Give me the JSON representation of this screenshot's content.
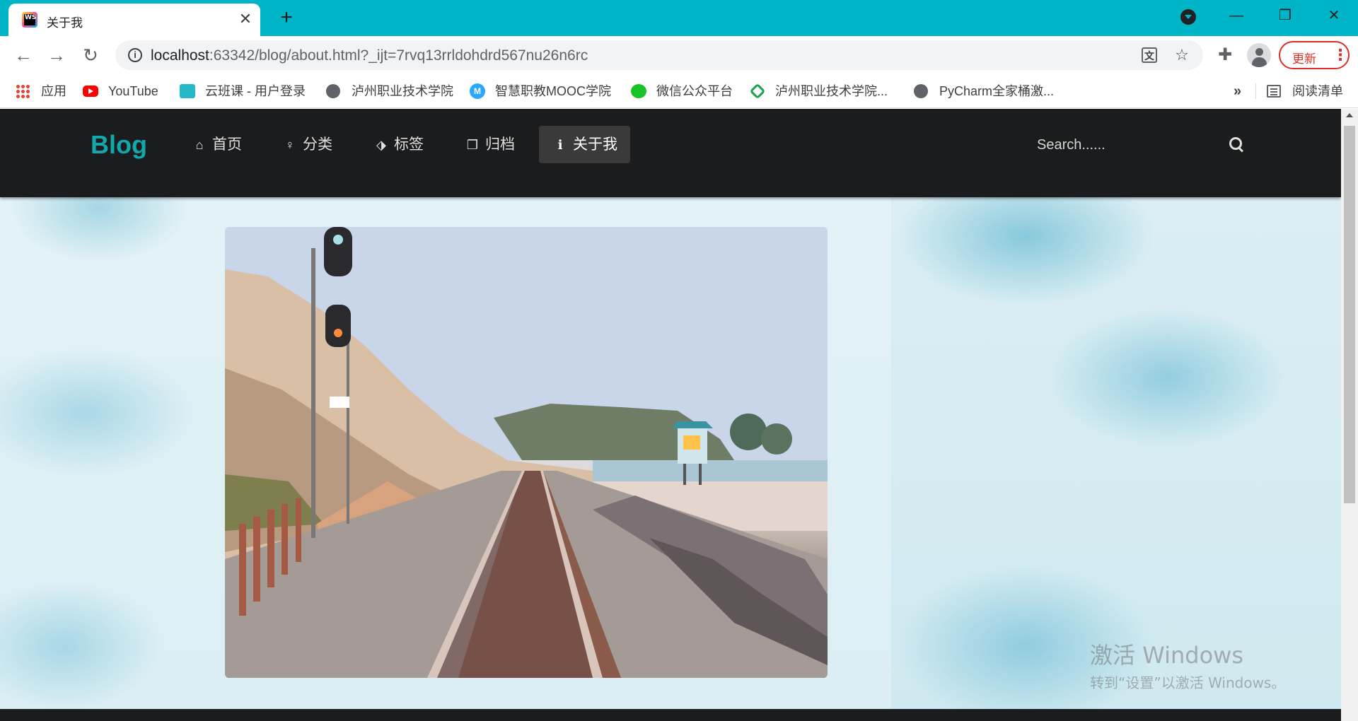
{
  "browser": {
    "tab_title": "关于我",
    "tab_close": "✕",
    "new_tab": "+",
    "window_controls": {
      "minimize": "—",
      "restore": "❐",
      "close": "✕"
    },
    "url_host": "localhost",
    "url_rest": ":63342/blog/about.html?_ijt=7rvq13rrldohdrd567nu26n6rc",
    "update_label": "更新",
    "update_menu": "⋮",
    "bookmarks": [
      {
        "label": "应用",
        "icon": "apps-grid-icon"
      },
      {
        "label": "YouTube",
        "icon": "youtube-icon"
      },
      {
        "label": "云班课 - 用户登录",
        "icon": "cloud-class-icon"
      },
      {
        "label": "泸州职业技术学院",
        "icon": "globe-icon"
      },
      {
        "label": "智慧职教MOOC学院",
        "icon": "mooc-icon"
      },
      {
        "label": "微信公众平台",
        "icon": "wechat-icon"
      },
      {
        "label": "泸州职业技术学院...",
        "icon": "school-icon"
      },
      {
        "label": "PyCharm全家桶激...",
        "icon": "globe-icon"
      }
    ],
    "bookmarks_more": "»",
    "reading_list": "阅读清单",
    "mooc_letter": "M"
  },
  "site": {
    "brand": "Blog",
    "menu": [
      {
        "label": "首页",
        "icon": "home-icon",
        "glyph": "⌂",
        "active": false
      },
      {
        "label": "分类",
        "icon": "lightbulb-icon",
        "glyph": "♀",
        "active": false
      },
      {
        "label": "标签",
        "icon": "tags-icon",
        "glyph": "⬗",
        "active": false
      },
      {
        "label": "归档",
        "icon": "clone-icon",
        "glyph": "❐",
        "active": false
      },
      {
        "label": "关于我",
        "icon": "info-icon",
        "glyph": "ℹ",
        "active": true
      }
    ],
    "search_placeholder": "Search......"
  },
  "watermark": {
    "line1": "激活 Windows",
    "line2": "转到“设置”以激活 Windows。"
  },
  "colors": {
    "browser_accent": "#00b4c8",
    "brand": "#12a8ad",
    "navbar_bg": "#1b1c1d",
    "update_red": "#d93025"
  }
}
